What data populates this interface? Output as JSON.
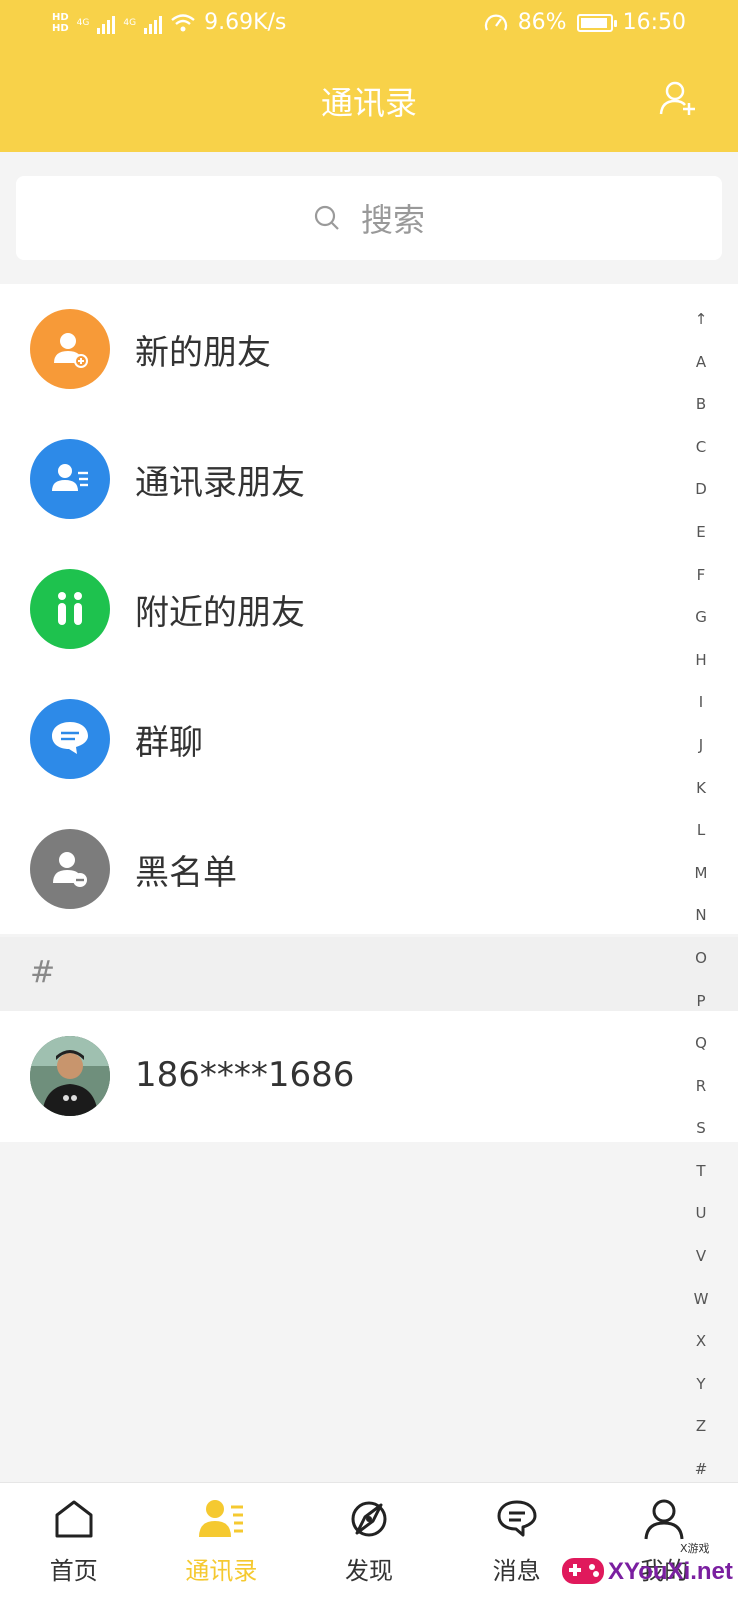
{
  "status_bar": {
    "hd1": "HD",
    "hd2": "HD",
    "net1": "4G",
    "net2": "4G",
    "speed": "9.69K/s",
    "battery": "86%",
    "time": "16:50"
  },
  "header": {
    "title": "通讯录"
  },
  "search": {
    "placeholder": "搜索"
  },
  "menu": [
    {
      "label": "新的朋友",
      "color": "#f79a38",
      "icon": "add-user-icon"
    },
    {
      "label": "通讯录朋友",
      "color": "#2d8ae8",
      "icon": "contact-card-icon"
    },
    {
      "label": "附近的朋友",
      "color": "#1ec24e",
      "icon": "nearby-people-icon"
    },
    {
      "label": "群聊",
      "color": "#2d8ae8",
      "icon": "group-chat-icon"
    },
    {
      "label": "黑名单",
      "color": "#7c7c7c",
      "icon": "remove-user-icon"
    }
  ],
  "section": {
    "letter": "#"
  },
  "contacts": [
    {
      "name": "186****1686"
    }
  ],
  "index_letters": [
    "↑",
    "A",
    "B",
    "C",
    "D",
    "E",
    "F",
    "G",
    "H",
    "I",
    "J",
    "K",
    "L",
    "M",
    "N",
    "O",
    "P",
    "Q",
    "R",
    "S",
    "T",
    "U",
    "V",
    "W",
    "X",
    "Y",
    "Z",
    "#"
  ],
  "tabs": [
    {
      "label": "首页",
      "icon": "home-icon"
    },
    {
      "label": "通讯录",
      "icon": "contacts-icon",
      "active": true
    },
    {
      "label": "发现",
      "icon": "discover-icon"
    },
    {
      "label": "消息",
      "icon": "message-icon"
    },
    {
      "label": "我的",
      "icon": "profile-icon"
    }
  ],
  "watermark": {
    "text": "XYouXi.net",
    "small": "X游戏"
  },
  "colors": {
    "brand": "#f8d249",
    "active_tab": "#f5c930"
  }
}
